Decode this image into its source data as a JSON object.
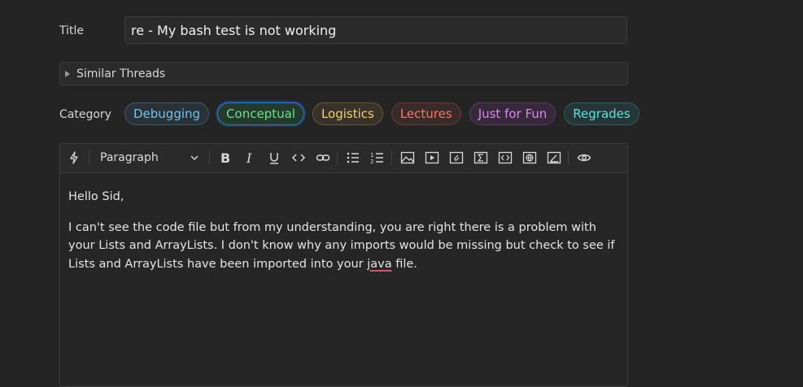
{
  "form": {
    "title_label": "Title",
    "title_value": "re - My bash test is not working",
    "similar_threads": "Similar Threads",
    "category_label": "Category"
  },
  "categories": [
    {
      "label": "Debugging",
      "color": "#6ec4ec"
    },
    {
      "label": "Conceptual",
      "color": "#6fe08a",
      "selected": true
    },
    {
      "label": "Logistics",
      "color": "#f0d070"
    },
    {
      "label": "Lectures",
      "color": "#f07a6a"
    },
    {
      "label": "Just for Fun",
      "color": "#d98af0"
    },
    {
      "label": "Regrades",
      "color": "#5fe0dc"
    }
  ],
  "editor": {
    "block_style": "Paragraph",
    "toolbar_icons": [
      "bolt-icon",
      "bold-icon",
      "italic-icon",
      "underline-icon",
      "code-icon",
      "link-icon",
      "bullet-list-icon",
      "numbered-list-icon",
      "image-icon",
      "video-icon",
      "attachment-icon",
      "math-icon",
      "code-block-icon",
      "web-embed-icon",
      "draw-icon",
      "preview-icon"
    ],
    "paragraph1": "Hello Sid,",
    "paragraph2_before": "I can't see the code file but from my understanding, you are right there is a problem with your Lists and ArrayLists. I don't know why any imports would be missing but check to see if Lists and ArrayLists have been imported into your ",
    "paragraph2_misspelled": "java",
    "paragraph2_after": " file."
  }
}
